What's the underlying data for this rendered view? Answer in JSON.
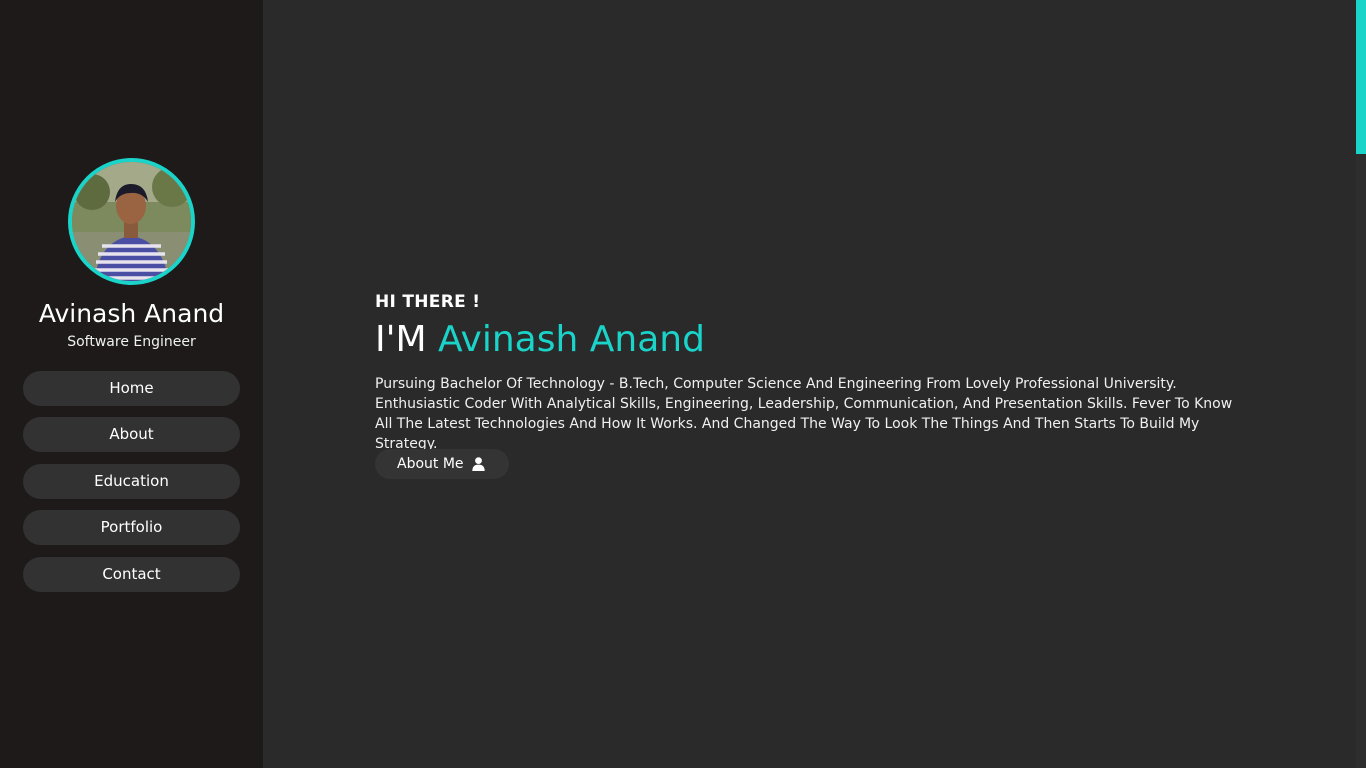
{
  "sidebar": {
    "profile": {
      "name": "Avinash Anand",
      "role": "Software Engineer"
    },
    "nav": [
      {
        "label": "Home"
      },
      {
        "label": "About"
      },
      {
        "label": "Education"
      },
      {
        "label": "Portfolio"
      },
      {
        "label": "Contact"
      }
    ]
  },
  "hero": {
    "greeting": "HI THERE !",
    "prefix": "I'M",
    "name": "Avinash Anand",
    "intro": "Pursuing Bachelor Of Technology - B.Tech, Computer Science And Engineering From Lovely Professional University. Enthusiastic Coder With Analytical Skills, Engineering, Leadership, Communication, And Presentation Skills. Fever To Know All The Latest Technologies And How It Works. And Changed The Way To Look The Things And Then Starts To Build My Strategy.",
    "button_label": "About Me",
    "button_icon": "user-icon"
  },
  "colors": {
    "accent": "#1ad3c9",
    "sidebar_bg": "#1d1a19",
    "main_bg": "#2b2a2b",
    "nav_item_bg": "#333233"
  }
}
